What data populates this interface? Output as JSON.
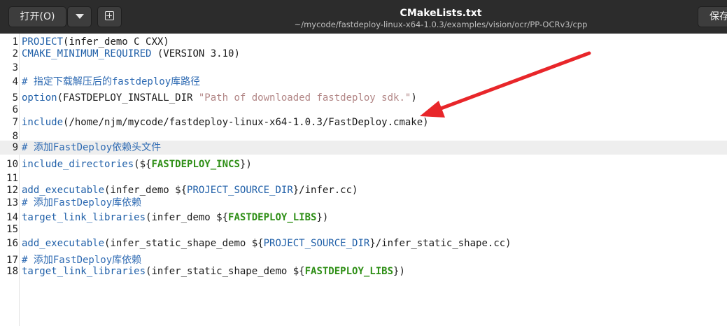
{
  "header": {
    "open_label": "打开(O)",
    "menu_icon": "chevron-down-icon",
    "new_tab_icon": "new-document-icon",
    "title": "CMakeLists.txt",
    "path": "~/mycode/fastdeploy-linux-x64-1.0.3/examples/vision/ocr/PP-OCRv3/cpp",
    "save_label": "保存"
  },
  "editor": {
    "current_line": 9,
    "lines": [
      {
        "n": "1",
        "segments": [
          {
            "t": "PROJECT",
            "c": "kw"
          },
          {
            "t": "(infer_demo C CXX)",
            "c": "pl"
          }
        ]
      },
      {
        "n": "2",
        "segments": [
          {
            "t": "CMAKE_MINIMUM_REQUIRED",
            "c": "kw"
          },
          {
            "t": " (VERSION 3.10)",
            "c": "pl"
          }
        ]
      },
      {
        "n": "3",
        "segments": []
      },
      {
        "n": "4",
        "segments": [
          {
            "t": "# 指定下载解压后的fastdeploy库路径",
            "c": "cm"
          }
        ]
      },
      {
        "n": "5",
        "segments": [
          {
            "t": "option",
            "c": "kw"
          },
          {
            "t": "(FASTDEPLOY_INSTALL_DIR ",
            "c": "pl"
          },
          {
            "t": "\"Path of downloaded fastdeploy sdk.\"",
            "c": "str"
          },
          {
            "t": ")",
            "c": "pl"
          }
        ]
      },
      {
        "n": "6",
        "segments": []
      },
      {
        "n": "7",
        "segments": [
          {
            "t": "include",
            "c": "kw"
          },
          {
            "t": "(/home/njm/mycode/fastdeploy-linux-x64-1.0.3/FastDeploy.cmake)",
            "c": "pl"
          }
        ]
      },
      {
        "n": "8",
        "segments": []
      },
      {
        "n": "9",
        "segments": [
          {
            "t": "# 添加FastDeploy依赖头文件",
            "c": "cm"
          }
        ]
      },
      {
        "n": "10",
        "segments": [
          {
            "t": "include_directories",
            "c": "kw"
          },
          {
            "t": "(${",
            "c": "pl"
          },
          {
            "t": "FASTDEPLOY_INCS",
            "c": "var"
          },
          {
            "t": "})",
            "c": "pl"
          }
        ]
      },
      {
        "n": "11",
        "segments": []
      },
      {
        "n": "12",
        "segments": [
          {
            "t": "add_executable",
            "c": "kw"
          },
          {
            "t": "(infer_demo ${",
            "c": "pl"
          },
          {
            "t": "PROJECT_SOURCE_DIR",
            "c": "kw"
          },
          {
            "t": "}/infer.cc)",
            "c": "pl"
          }
        ]
      },
      {
        "n": "13",
        "segments": [
          {
            "t": "# 添加FastDeploy库依赖",
            "c": "cm"
          }
        ]
      },
      {
        "n": "14",
        "segments": [
          {
            "t": "target_link_libraries",
            "c": "kw"
          },
          {
            "t": "(infer_demo ${",
            "c": "pl"
          },
          {
            "t": "FASTDEPLOY_LIBS",
            "c": "var"
          },
          {
            "t": "})",
            "c": "pl"
          }
        ]
      },
      {
        "n": "15",
        "segments": []
      },
      {
        "n": "16",
        "segments": [
          {
            "t": "add_executable",
            "c": "kw"
          },
          {
            "t": "(infer_static_shape_demo ${",
            "c": "pl"
          },
          {
            "t": "PROJECT_SOURCE_DIR",
            "c": "kw"
          },
          {
            "t": "}/infer_static_shape.cc)",
            "c": "pl"
          }
        ]
      },
      {
        "n": "17",
        "segments": [
          {
            "t": "# 添加FastDeploy库依赖",
            "c": "cm"
          }
        ]
      },
      {
        "n": "18",
        "segments": [
          {
            "t": "target_link_libraries",
            "c": "kw"
          },
          {
            "t": "(infer_static_shape_demo ${",
            "c": "pl"
          },
          {
            "t": "FASTDEPLOY_LIBS",
            "c": "var"
          },
          {
            "t": "})",
            "c": "pl"
          }
        ]
      }
    ]
  },
  "annotation": {
    "icon": "red-arrow-annotation",
    "color": "#e8262a"
  },
  "colors": {
    "header_bg": "#2c2c2c",
    "keyword": "#1f5fa8",
    "string": "#b28686",
    "comment": "#2f6bb3",
    "variable": "#2f8f17"
  }
}
